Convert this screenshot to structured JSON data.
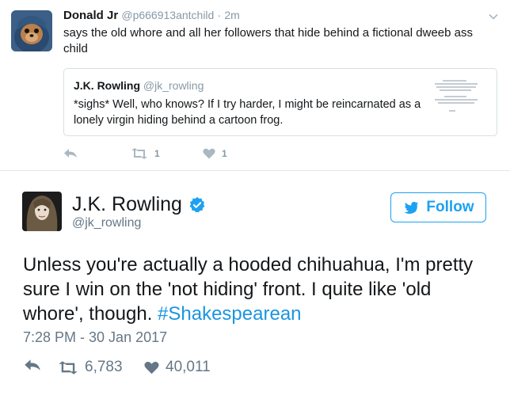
{
  "reply_tweet": {
    "author_name": "Donald Jr",
    "author_handle": "@p666913antchild",
    "separator": "·",
    "timestamp": "2m",
    "text": "says the old whore and all her followers that hide behind a fictional dweeb ass child",
    "quoted": {
      "author_name": "J.K. Rowling",
      "author_handle": "@jk_rowling",
      "text": "*sighs* Well, who knows? If I try harder, I might be reincarnated as a lonely virgin hiding behind a cartoon frog."
    },
    "retweet_count": "1",
    "like_count": "1"
  },
  "main_tweet": {
    "author_name": "J.K. Rowling",
    "author_handle": "@jk_rowling",
    "follow_label": "Follow",
    "text_before": "Unless you're actually a hooded chihuahua, I'm pretty sure I win on the 'not hiding' front. I quite like 'old whore', though. ",
    "hashtag": "#Shakespearean",
    "timestamp": "7:28 PM - 30 Jan 2017",
    "retweet_count": "6,783",
    "like_count": "40,011"
  },
  "colors": {
    "twitter_blue": "#1da1f2",
    "hashtag_blue": "#1b95e0",
    "secondary_text": "#657786",
    "muted_text": "#8899a6",
    "divider": "#e1e8ed"
  },
  "icons": [
    "reply-icon",
    "retweet-icon",
    "heart-icon",
    "verified-badge-icon",
    "twitter-bird-icon",
    "chevron-down-icon"
  ]
}
